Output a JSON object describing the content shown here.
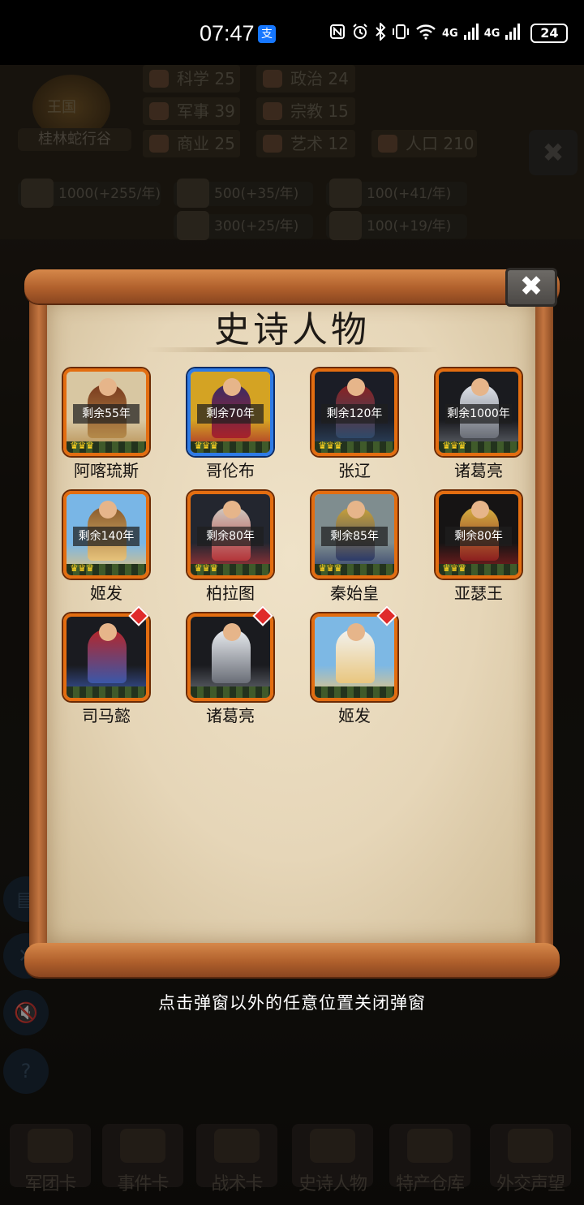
{
  "status_bar": {
    "time": "07:47",
    "pay_glyph": "支",
    "icons": [
      "nfc-icon",
      "alarm-icon",
      "bluetooth-icon",
      "vibrate-icon",
      "wifi-icon"
    ],
    "net1": "4G",
    "net2": "4G",
    "battery": "24"
  },
  "background": {
    "kingdom_label": "王国",
    "kingdom_name": "桂林蛇行谷",
    "stats": [
      {
        "label": "科学",
        "value": "25"
      },
      {
        "label": "政治",
        "value": "24"
      },
      {
        "label": "军事",
        "value": "39"
      },
      {
        "label": "宗教",
        "value": "15"
      },
      {
        "label": "商业",
        "value": "25"
      },
      {
        "label": "艺术",
        "value": "12"
      },
      {
        "label": "人口",
        "value": "210"
      }
    ],
    "resources": [
      "1000(+255/年)",
      "500(+35/年)",
      "100(+41/年)",
      "300(+25/年)",
      "100(+19/年)"
    ],
    "dock": [
      "军团卡",
      "事件卡",
      "战术卡",
      "史诗人物",
      "特产仓库",
      "外交声望"
    ]
  },
  "dialog": {
    "title": "史诗人物",
    "close_glyph": "✖",
    "characters": [
      {
        "name": "阿喀琉斯",
        "remaining": "剩余55年",
        "frame": "orange",
        "new": false,
        "palette": [
          "#d8c7a2",
          "#b48a4a",
          "#7a3b1e"
        ]
      },
      {
        "name": "哥伦布",
        "remaining": "剩余70年",
        "frame": "blue",
        "new": false,
        "palette": [
          "#d4a323",
          "#a8222a",
          "#3a2c64"
        ]
      },
      {
        "name": "张辽",
        "remaining": "剩余120年",
        "frame": "orange",
        "new": false,
        "palette": [
          "#1b1d26",
          "#2f4a6a",
          "#8a2222"
        ]
      },
      {
        "name": "诸葛亮",
        "remaining": "剩余1000年",
        "frame": "orange",
        "new": false,
        "palette": [
          "#1a1b1f",
          "#6a6e77",
          "#dfe3ea"
        ]
      },
      {
        "name": "姬发",
        "remaining": "剩余140年",
        "frame": "orange",
        "new": false,
        "palette": [
          "#79b6e6",
          "#e6c27a",
          "#8a5a2a"
        ]
      },
      {
        "name": "柏拉图",
        "remaining": "剩余80年",
        "frame": "orange",
        "new": false,
        "palette": [
          "#23262f",
          "#b4353a",
          "#cfcac0"
        ]
      },
      {
        "name": "秦始皇",
        "remaining": "剩余85年",
        "frame": "orange",
        "new": false,
        "palette": [
          "#7f8d8f",
          "#2c3b6a",
          "#c9a23a"
        ]
      },
      {
        "name": "亚瑟王",
        "remaining": "剩余80年",
        "frame": "orange",
        "new": false,
        "palette": [
          "#161414",
          "#8c1f1f",
          "#d4b040"
        ]
      },
      {
        "name": "司马懿",
        "remaining": "",
        "frame": "orange",
        "new": true,
        "palette": [
          "#1a1b20",
          "#3a57a8",
          "#b5262a"
        ]
      },
      {
        "name": "诸葛亮",
        "remaining": "",
        "frame": "orange",
        "new": true,
        "palette": [
          "#1a1b1f",
          "#6a6e77",
          "#e8ebef"
        ]
      },
      {
        "name": "姬发",
        "remaining": "",
        "frame": "orange",
        "new": true,
        "palette": [
          "#7db8e4",
          "#e9c67f",
          "#f2f2ef"
        ]
      }
    ]
  },
  "hint": "点击弹窗以外的任意位置关闭弹窗"
}
